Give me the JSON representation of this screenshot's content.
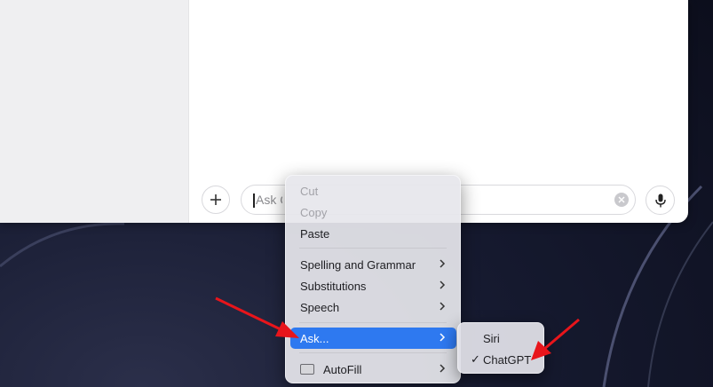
{
  "input": {
    "placeholder": "Ask ChatGPT"
  },
  "context_menu": {
    "items": [
      {
        "label": "Cut",
        "disabled": true
      },
      {
        "label": "Copy",
        "disabled": true
      },
      {
        "label": "Paste"
      },
      {
        "label": "Spelling and Grammar",
        "submenu": true
      },
      {
        "label": "Substitutions",
        "submenu": true
      },
      {
        "label": "Speech",
        "submenu": true
      },
      {
        "label": "Ask...",
        "submenu": true,
        "highlighted": true
      },
      {
        "label": "AutoFill",
        "submenu": true,
        "icon": "autofill-icon"
      }
    ]
  },
  "ask_submenu": {
    "items": [
      {
        "label": "Siri",
        "checked": false
      },
      {
        "label": "ChatGPT",
        "checked": true
      }
    ]
  },
  "colors": {
    "highlight": "#2e79f0",
    "annotation_arrow": "#e8151b"
  },
  "icons": {
    "plus": "plus-icon",
    "mic": "microphone-icon",
    "clear": "clear-icon",
    "chevron": "chevron-right-icon",
    "check": "checkmark-icon"
  }
}
